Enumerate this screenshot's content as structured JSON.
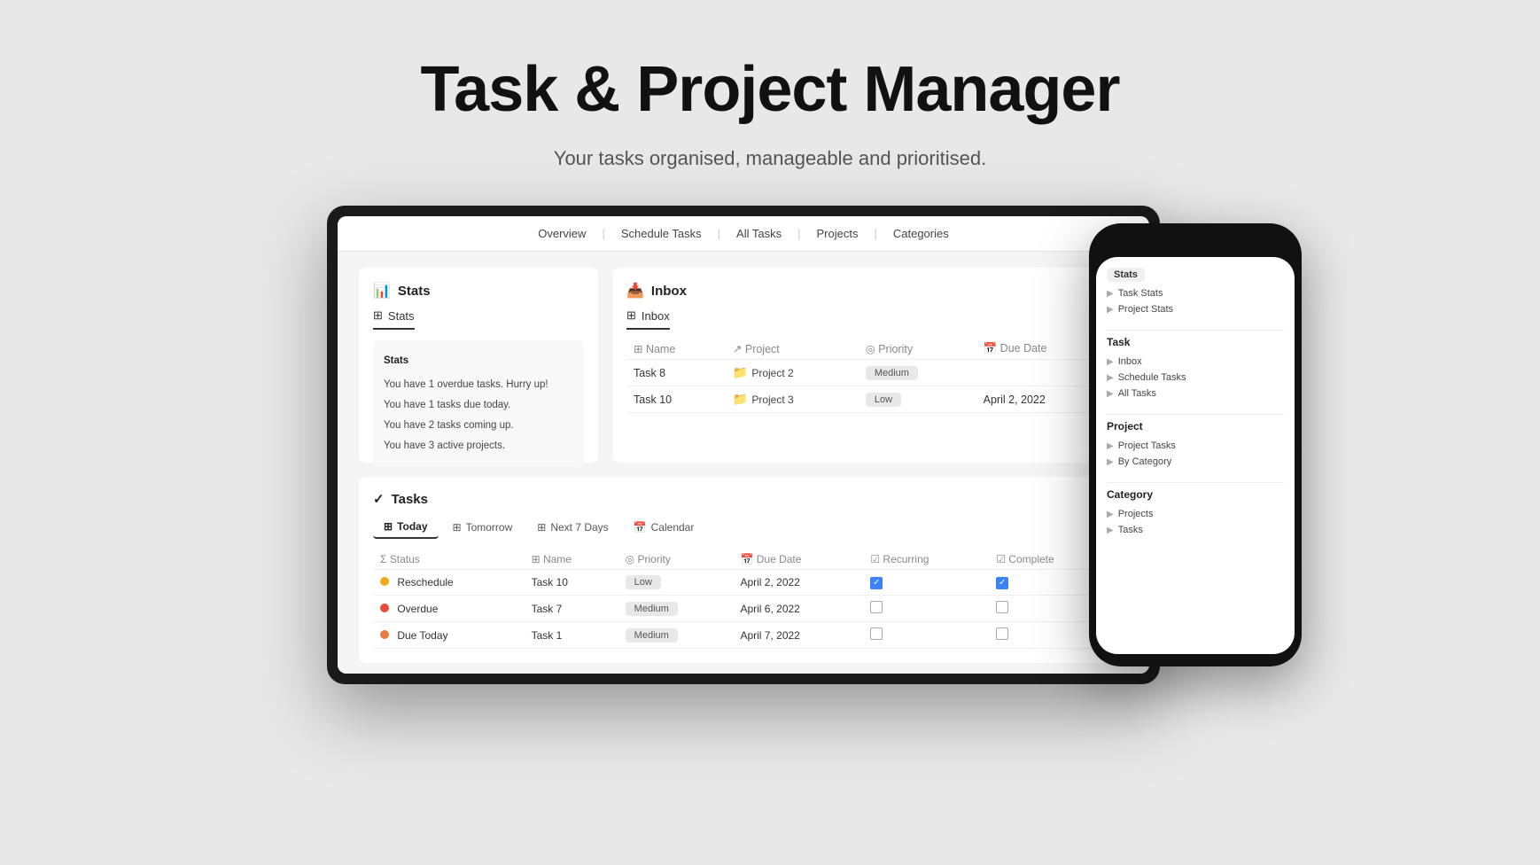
{
  "hero": {
    "title": "Task & Project Manager",
    "subtitle": "Your tasks organised, manageable and prioritised."
  },
  "app": {
    "nav": {
      "items": [
        "Overview",
        "Schedule Tasks",
        "All Tasks",
        "Projects",
        "Categories"
      ]
    },
    "stats": {
      "panel_title": "Stats",
      "tab_label": "Stats",
      "inner_title": "Stats",
      "messages": [
        "You have 1 overdue tasks. Hurry up!",
        "You have 1 tasks due today.",
        "You have 2 tasks coming up.",
        "You have 3 active projects."
      ]
    },
    "inbox": {
      "panel_title": "Inbox",
      "tab_label": "Inbox",
      "columns": [
        "Name",
        "Project",
        "Priority",
        "Due Date"
      ],
      "rows": [
        {
          "name": "Task 8",
          "project": "Project 2",
          "priority": "Medium",
          "due_date": ""
        },
        {
          "name": "Task 10",
          "project": "Project 3",
          "priority": "Low",
          "due_date": "April 2, 2022"
        }
      ]
    },
    "tasks": {
      "section_title": "Tasks",
      "tabs": [
        "Today",
        "Tomorrow",
        "Next 7 Days",
        "Calendar"
      ],
      "active_tab": "Today",
      "columns": [
        "Status",
        "Name",
        "Priority",
        "Due Date",
        "Recurring",
        "Complete"
      ],
      "rows": [
        {
          "status": "Reschedule",
          "status_color": "yellow",
          "name": "Task 10",
          "priority": "Low",
          "priority_color": "low",
          "due_date": "April 2, 2022",
          "recurring": true,
          "complete": true
        },
        {
          "status": "Overdue",
          "status_color": "red",
          "name": "Task 7",
          "priority": "Medium",
          "priority_color": "medium",
          "due_date": "April 6, 2022",
          "recurring": false,
          "complete": false
        },
        {
          "status": "Due Today",
          "status_color": "orange",
          "name": "Task 1",
          "priority": "Medium",
          "priority_color": "medium",
          "due_date": "April 7, 2022",
          "recurring": false,
          "complete": false
        }
      ]
    }
  },
  "phone": {
    "sections": [
      {
        "title": "Stats",
        "items": [
          {
            "label": "Task Stats",
            "arrow": "▶"
          },
          {
            "label": "Project Stats",
            "arrow": "▶"
          }
        ]
      },
      {
        "title": "Task",
        "items": [
          {
            "label": "Inbox",
            "arrow": "▶"
          },
          {
            "label": "Schedule Tasks",
            "arrow": "▶"
          },
          {
            "label": "All Tasks",
            "arrow": "▶"
          }
        ]
      },
      {
        "title": "Project",
        "items": [
          {
            "label": "Project Tasks",
            "arrow": "▶"
          },
          {
            "label": "By Category",
            "arrow": "▶"
          }
        ]
      },
      {
        "title": "Category",
        "items": [
          {
            "label": "Projects",
            "arrow": "▶"
          },
          {
            "label": "Tasks",
            "arrow": "▶"
          }
        ]
      }
    ]
  },
  "icons": {
    "checkmark": "✓",
    "stats_chart": "📊",
    "inbox": "📥",
    "folder": "📁",
    "grid": "⊞",
    "calendar": "📅",
    "arrow_right": "▶"
  }
}
